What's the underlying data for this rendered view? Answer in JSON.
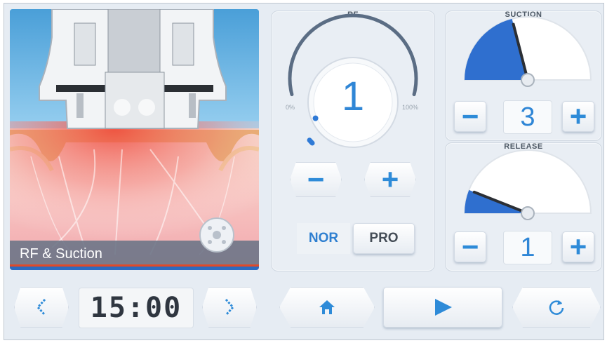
{
  "illustration": {
    "caption": "RF & Suction"
  },
  "rf": {
    "title": "RF",
    "value": "1",
    "level_fraction": 0.01,
    "min_label": "0%",
    "max_label": "100%",
    "minus_symbol": "−",
    "plus_symbol": "+",
    "modes": [
      "NOR",
      "PRO"
    ],
    "active_mode": "NOR"
  },
  "suction": {
    "title": "SUCTION",
    "value": "3",
    "level_fraction": 0.42,
    "minus_symbol": "−",
    "plus_symbol": "+"
  },
  "release": {
    "title": "RELEASE",
    "value": "1",
    "level_fraction": 0.12,
    "minus_symbol": "−",
    "plus_symbol": "+"
  },
  "timer": {
    "value": "15:00"
  },
  "colors": {
    "accent": "#2e8bd8",
    "background": "#e6ecf3",
    "gauge_fill": "#2f6fcf",
    "digit_dark": "#2f3640"
  },
  "icons": [
    "chevron-left-icon",
    "chevron-right-icon",
    "home-icon",
    "play-icon",
    "reset-icon"
  ]
}
